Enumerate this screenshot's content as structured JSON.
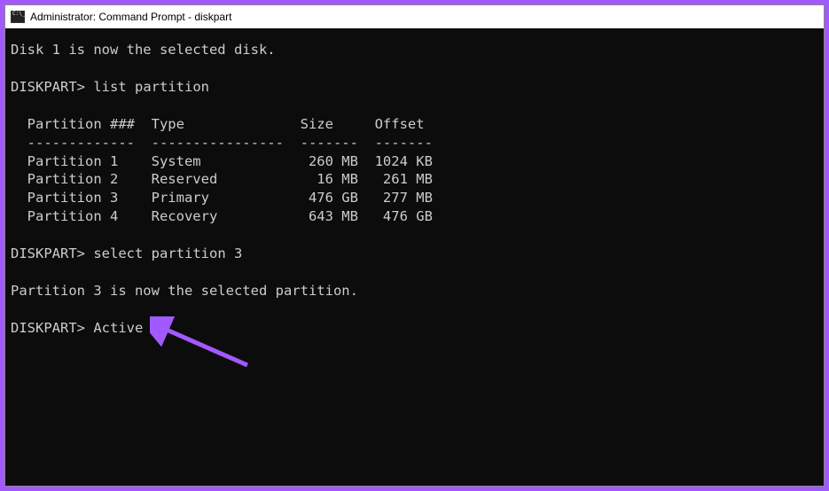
{
  "titlebar": {
    "title": "Administrator: Command Prompt - diskpart"
  },
  "terminal": {
    "msg_disk_selected": "Disk 1 is now the selected disk.",
    "prompt": "DISKPART>",
    "cmd_list_partition": "list partition",
    "table_header": "  Partition ###  Type              Size     Offset",
    "table_divider": "  -------------  ----------------  -------  -------",
    "row1": "  Partition 1    System             260 MB  1024 KB",
    "row2": "  Partition 2    Reserved            16 MB   261 MB",
    "row3": "  Partition 3    Primary            476 GB   277 MB",
    "row4": "  Partition 4    Recovery           643 MB   476 GB",
    "cmd_select_partition": "select partition 3",
    "msg_partition_selected": "Partition 3 is now the selected partition.",
    "cmd_active": "Active"
  }
}
